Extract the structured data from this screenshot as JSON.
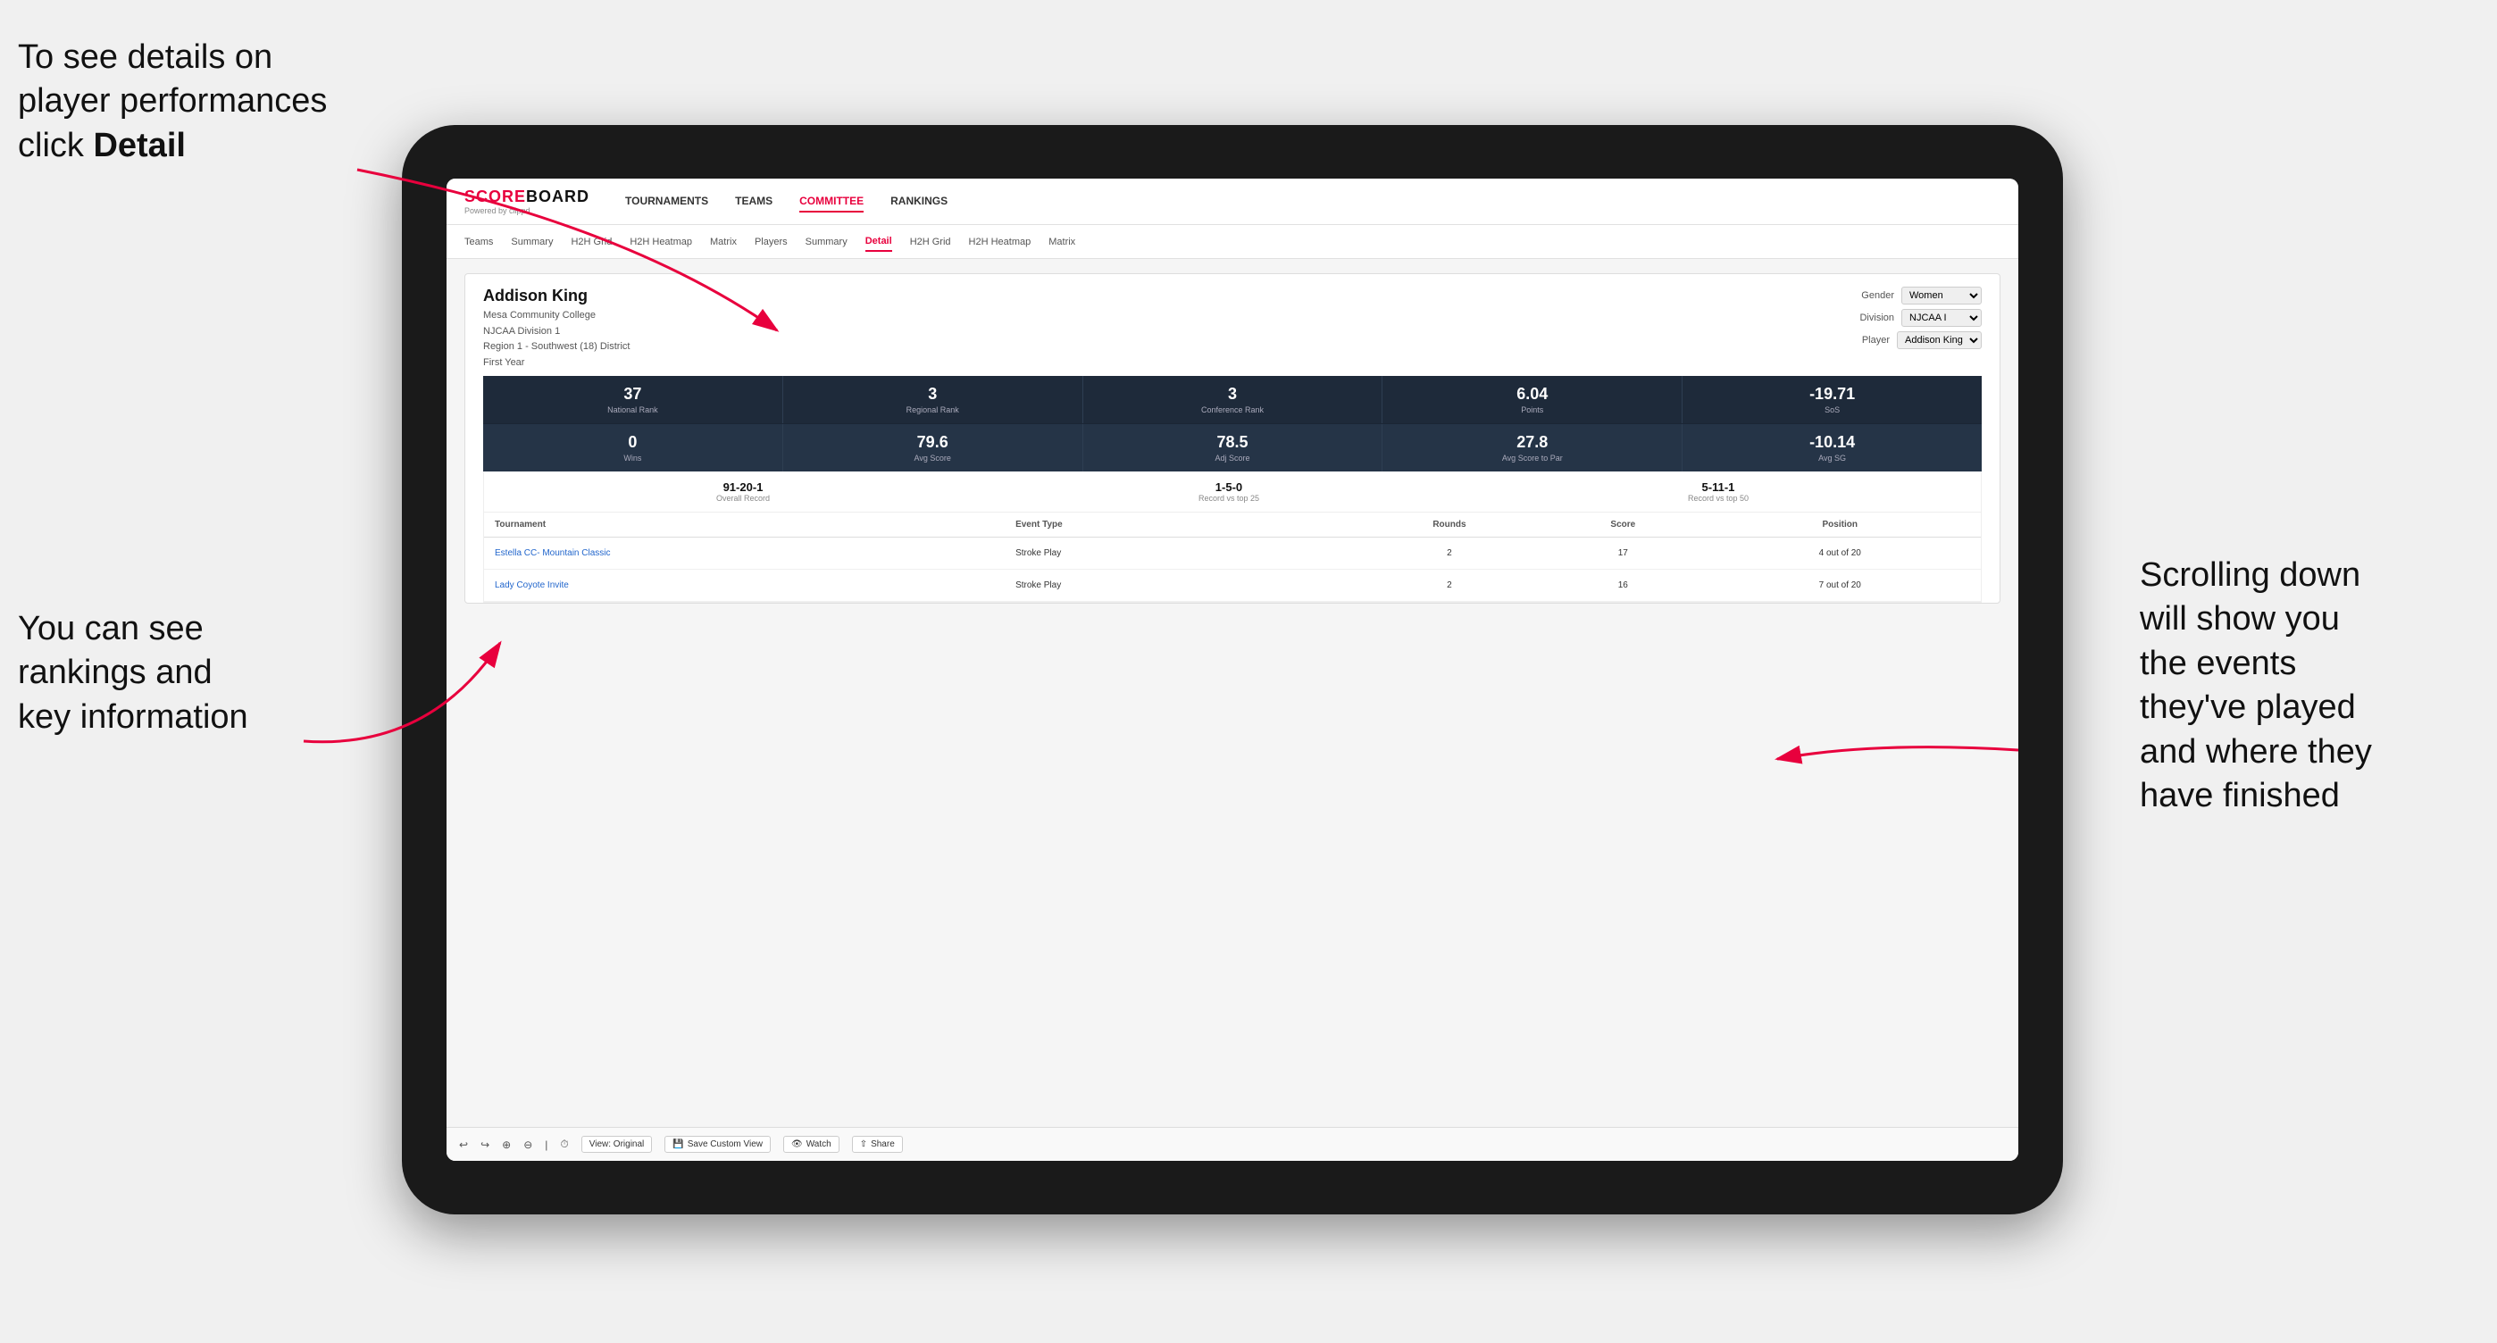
{
  "annotations": {
    "top_left": "To see details on player performances click ",
    "top_left_bold": "Detail",
    "bottom_left_line1": "You can see",
    "bottom_left_line2": "rankings and",
    "bottom_left_line3": "key information",
    "right_line1": "Scrolling down",
    "right_line2": "will show you",
    "right_line3": "the events",
    "right_line4": "they've played",
    "right_line5": "and where they",
    "right_line6": "have finished"
  },
  "nav": {
    "logo": "SCOREBOARD",
    "logo_sub": "Powered by clippd",
    "items": [
      "TOURNAMENTS",
      "TEAMS",
      "COMMITTEE",
      "RANKINGS"
    ],
    "active": "COMMITTEE"
  },
  "sub_tabs": {
    "items": [
      "Teams",
      "Summary",
      "H2H Grid",
      "H2H Heatmap",
      "Matrix",
      "Players",
      "Summary",
      "Detail",
      "H2H Grid",
      "H2H Heatmap",
      "Matrix"
    ],
    "active": "Detail"
  },
  "player": {
    "name": "Addison King",
    "college": "Mesa Community College",
    "division": "NJCAA Division 1",
    "region": "Region 1 - Southwest (18) District",
    "year": "First Year",
    "gender_label": "Gender",
    "gender_value": "Women",
    "division_label": "Division",
    "division_value": "NJCAA I",
    "player_label": "Player",
    "player_value": "Addison King"
  },
  "stats_row1": [
    {
      "value": "37",
      "label": "National Rank"
    },
    {
      "value": "3",
      "label": "Regional Rank"
    },
    {
      "value": "3",
      "label": "Conference Rank"
    },
    {
      "value": "6.04",
      "label": "Points"
    },
    {
      "value": "-19.71",
      "label": "SoS"
    }
  ],
  "stats_row2": [
    {
      "value": "0",
      "label": "Wins"
    },
    {
      "value": "79.6",
      "label": "Avg Score"
    },
    {
      "value": "78.5",
      "label": "Adj Score"
    },
    {
      "value": "27.8",
      "label": "Avg Score to Par"
    },
    {
      "value": "-10.14",
      "label": "Avg SG"
    }
  ],
  "records": [
    {
      "value": "91-20-1",
      "label": "Overall Record"
    },
    {
      "value": "1-5-0",
      "label": "Record vs top 25"
    },
    {
      "value": "5-11-1",
      "label": "Record vs top 50"
    }
  ],
  "table": {
    "headers": [
      "Tournament",
      "Event Type",
      "Rounds",
      "Score",
      "Position"
    ],
    "rows": [
      {
        "tournament": "Estella CC- Mountain Classic",
        "event_type": "Stroke Play",
        "rounds": "2",
        "score": "17",
        "position": "4 out of 20"
      },
      {
        "tournament": "Lady Coyote Invite",
        "event_type": "Stroke Play",
        "rounds": "2",
        "score": "16",
        "position": "7 out of 20"
      }
    ]
  },
  "toolbar": {
    "view_original": "View: Original",
    "save_custom": "Save Custom View",
    "watch": "Watch",
    "share": "Share"
  }
}
